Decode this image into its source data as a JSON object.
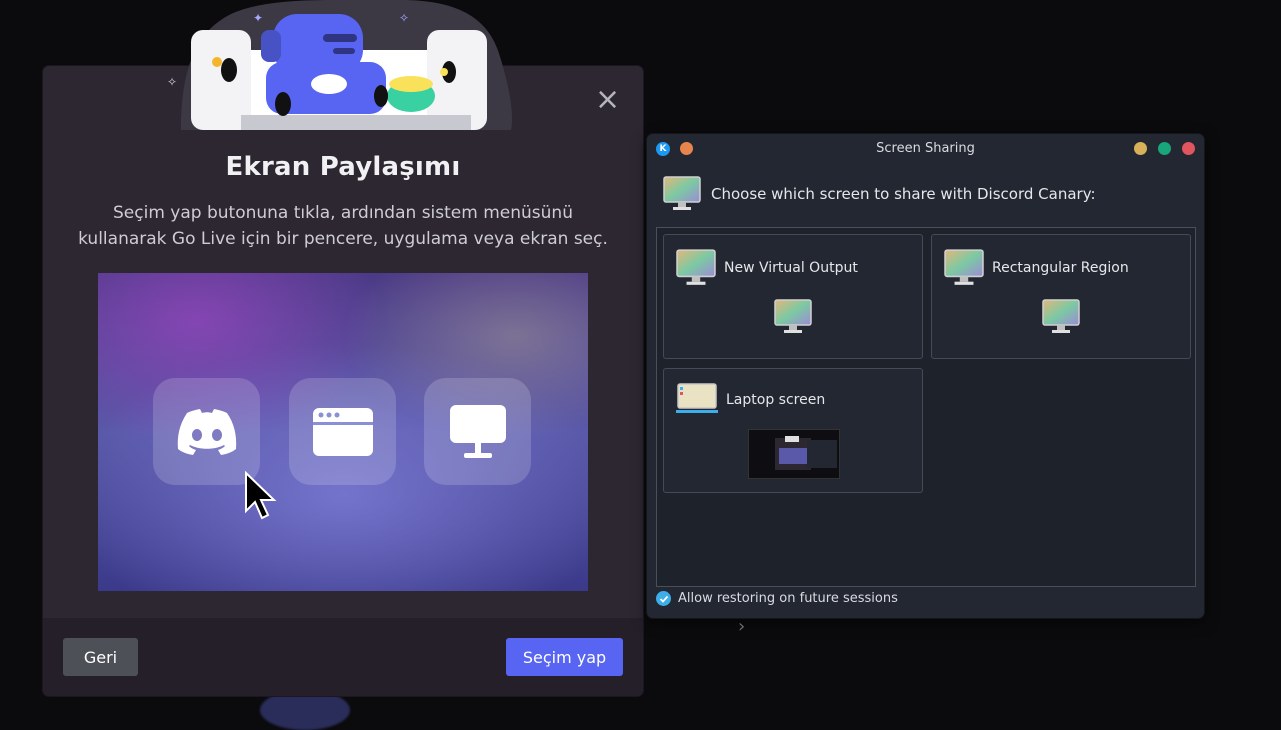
{
  "discord_modal": {
    "title": "Ekran Paylaşımı",
    "description": "Seçim yap butonuna tıkla, ardından sistem menüsünü kullanarak Go Live için bir pencere, uygulama veya ekran seç.",
    "close_icon": "close-icon",
    "back_button": "Geri",
    "select_button": "Seçim yap",
    "tiles": [
      "discord-logo-icon",
      "window-icon",
      "monitor-icon"
    ],
    "colors": {
      "accent": "#5865f2",
      "secondary_button": "#4e5058",
      "panel": "#2c2731"
    }
  },
  "screen_sharing": {
    "window_title": "Screen Sharing",
    "prompt": "Choose which screen to share with Discord Canary:",
    "options": [
      {
        "label": "New Virtual Output"
      },
      {
        "label": "Rectangular Region"
      },
      {
        "label": "Laptop screen"
      }
    ],
    "restore_checkbox": {
      "label": "Allow restoring on future sessions",
      "checked": true
    },
    "colors": {
      "minimize": "#d9b05a",
      "maximize": "#18a67a",
      "close": "#e0555e",
      "pin": "#e8854c",
      "check": "#3daee9"
    }
  }
}
